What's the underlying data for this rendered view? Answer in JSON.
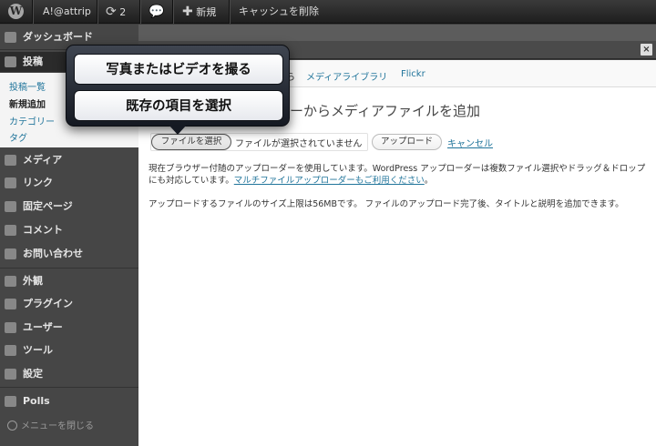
{
  "adminbar": {
    "site_name": "A!@attrip",
    "updates_count": "2",
    "new_label": "新規",
    "cache_label": "キャッシュを削除",
    "icons": [
      "wordpress-logo",
      "refresh-icon",
      "comment-bubble-icon",
      "plus-icon"
    ]
  },
  "sidebar": {
    "dashboard": "ダッシュボード",
    "posts": "投稿",
    "posts_sub": [
      "投稿一覧",
      "新規追加",
      "カテゴリー",
      "タグ"
    ],
    "items": [
      "メディア",
      "リンク",
      "固定ページ",
      "コメント",
      "お問い合わせ",
      "外観",
      "プラグイン",
      "ユーザー",
      "ツール",
      "設定",
      "Polls"
    ],
    "collapse": "メニューを閉じる"
  },
  "modal": {
    "close_glyph": "×",
    "tabs": [
      "ら",
      "メディアライブラリ",
      "Flickr"
    ],
    "heading": "ーからメディアファイルを追加",
    "file_button": "ファイルを選択",
    "no_file": "ファイルが選択されていません",
    "upload_button": "アップロード",
    "cancel": "キャンセル",
    "info1_text": "現在ブラウザー付随のアップローダーを使用しています。WordPress アップローダーは複数ファイル選択やドラッグ＆ドロップにも対応しています。",
    "info1_link": "マルチファイルアップローダーもご利用ください",
    "info1_end": "。",
    "info2": "アップロードするファイルのサイズ上限は56MBです。 ファイルのアップロード完了後、タイトルと説明を追加できます。"
  },
  "popover": {
    "option1": "写真またはビデオを撮る",
    "option2": "既存の項目を選択"
  },
  "colors": {
    "link": "#21759b",
    "adminbar": "#2a2a2a",
    "sidebar": "#464646"
  }
}
